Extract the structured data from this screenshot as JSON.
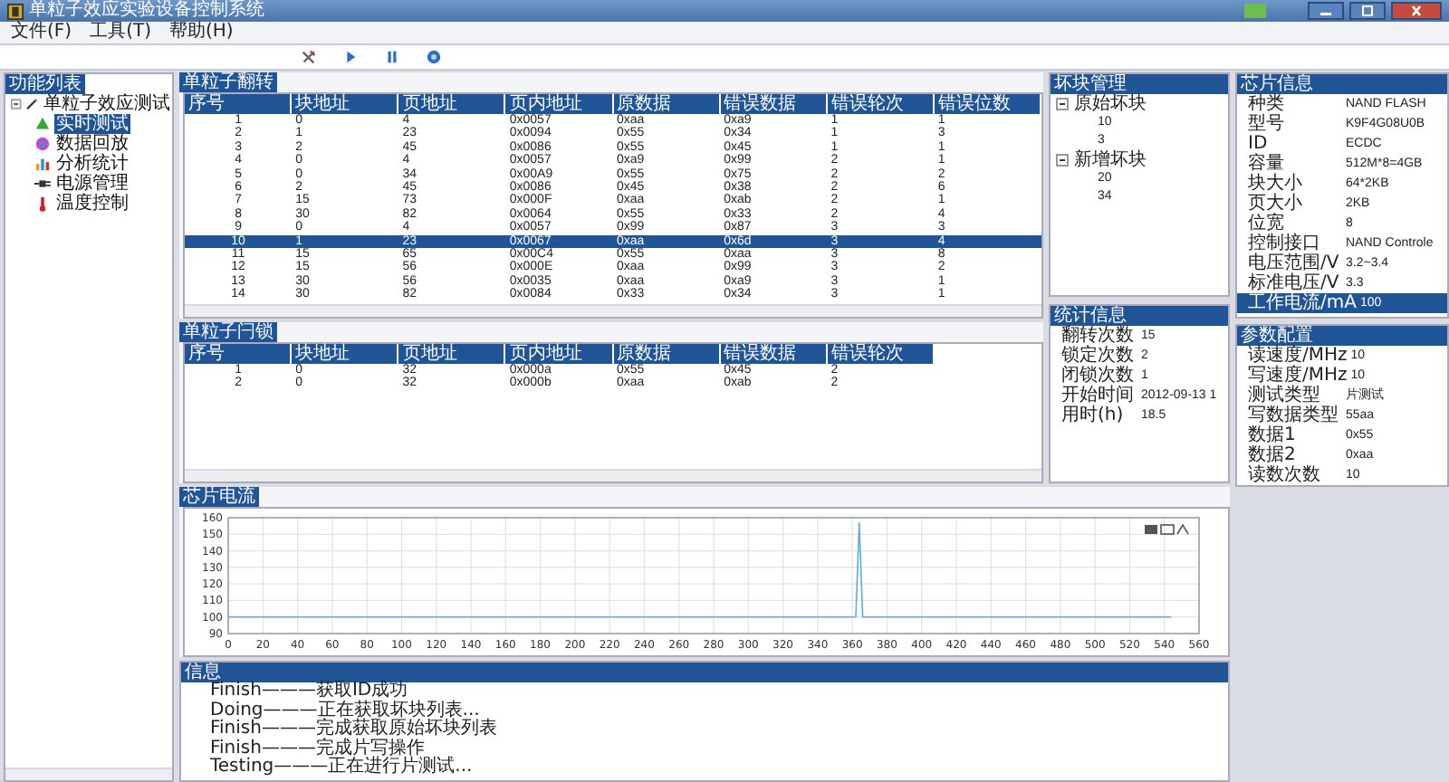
{
  "window": {
    "title": "单粒子效应实验设备控制系统"
  },
  "menu": [
    {
      "label": "文件(F)"
    },
    {
      "label": "工具(T)"
    },
    {
      "label": "帮助(H)"
    }
  ],
  "sidebar": {
    "title": "功能列表",
    "tree": [
      {
        "label": "单粒子效应测试",
        "expanded": true,
        "children": [
          {
            "label": "实时测试",
            "kind": "test",
            "selected": true
          },
          {
            "label": "数据回放",
            "kind": "playback",
            "selected": false
          },
          {
            "label": "分析统计",
            "kind": "stats",
            "selected": false
          },
          {
            "label": "电源管理",
            "kind": "power",
            "selected": false
          },
          {
            "label": "温度控制",
            "kind": "temperature",
            "selected": false
          }
        ]
      }
    ]
  },
  "upset_table": {
    "title": "单粒子翻转",
    "columns": [
      "序号",
      "块地址",
      "页地址",
      "页内地址",
      "原数据",
      "错误数据",
      "错误轮次",
      "错误位数"
    ],
    "rows": [
      {
        "cells": [
          "1",
          "0",
          "4",
          "0x0057",
          "0xaa",
          "0xa9",
          "1",
          "1"
        ],
        "selected": false
      },
      {
        "cells": [
          "2",
          "1",
          "23",
          "0x0094",
          "0x55",
          "0x34",
          "1",
          "3"
        ],
        "selected": false
      },
      {
        "cells": [
          "3",
          "2",
          "45",
          "0x0086",
          "0x55",
          "0x45",
          "1",
          "1"
        ],
        "selected": false
      },
      {
        "cells": [
          "4",
          "0",
          "4",
          "0x0057",
          "0xa9",
          "0x99",
          "2",
          "1"
        ],
        "selected": false
      },
      {
        "cells": [
          "5",
          "0",
          "34",
          "0x00A9",
          "0x55",
          "0x75",
          "2",
          "2"
        ],
        "selected": false
      },
      {
        "cells": [
          "6",
          "2",
          "45",
          "0x0086",
          "0x45",
          "0x38",
          "2",
          "6"
        ],
        "selected": false
      },
      {
        "cells": [
          "7",
          "15",
          "73",
          "0x000F",
          "0xaa",
          "0xab",
          "2",
          "1"
        ],
        "selected": false
      },
      {
        "cells": [
          "8",
          "30",
          "82",
          "0x0064",
          "0x55",
          "0x33",
          "2",
          "4"
        ],
        "selected": false
      },
      {
        "cells": [
          "9",
          "0",
          "4",
          "0x0057",
          "0x99",
          "0x87",
          "3",
          "3"
        ],
        "selected": false
      },
      {
        "cells": [
          "10",
          "1",
          "23",
          "0x0067",
          "0xaa",
          "0x6d",
          "3",
          "4"
        ],
        "selected": true
      },
      {
        "cells": [
          "11",
          "15",
          "65",
          "0x00C4",
          "0x55",
          "0xaa",
          "3",
          "8"
        ],
        "selected": false
      },
      {
        "cells": [
          "12",
          "15",
          "56",
          "0x000E",
          "0xaa",
          "0x99",
          "3",
          "2"
        ],
        "selected": false
      },
      {
        "cells": [
          "13",
          "30",
          "56",
          "0x0035",
          "0xaa",
          "0xa9",
          "3",
          "1"
        ],
        "selected": false
      },
      {
        "cells": [
          "14",
          "30",
          "82",
          "0x0084",
          "0x33",
          "0x34",
          "3",
          "1"
        ],
        "selected": false
      }
    ]
  },
  "latch_table": {
    "title": "单粒子闩锁",
    "columns": [
      "序号",
      "块地址",
      "页地址",
      "页内地址",
      "原数据",
      "错误数据",
      "错误轮次"
    ],
    "rows": [
      {
        "cells": [
          "1",
          "0",
          "32",
          "0x000a",
          "0x55",
          "0x45",
          "2"
        ],
        "selected": false
      },
      {
        "cells": [
          "2",
          "0",
          "32",
          "0x000b",
          "0xaa",
          "0xab",
          "2"
        ],
        "selected": false
      }
    ]
  },
  "bad_blocks": {
    "title": "坏块管理",
    "groups": [
      {
        "label": "原始坏块",
        "expanded": true,
        "children": [
          {
            "label": "10"
          },
          {
            "label": "3"
          }
        ]
      },
      {
        "label": "新增坏块",
        "expanded": true,
        "children": [
          {
            "label": "20"
          },
          {
            "label": "34"
          }
        ]
      }
    ]
  },
  "statistics": {
    "title": "统计信息",
    "rows": [
      {
        "key": "翻转次数",
        "value": "15"
      },
      {
        "key": "锁定次数",
        "value": "2"
      },
      {
        "key": "闭锁次数",
        "value": "1"
      },
      {
        "key": "开始时间",
        "value": "2012-09-13 1"
      },
      {
        "key": "用时(h)",
        "value": "18.5"
      }
    ]
  },
  "chip_info": {
    "title": "芯片信息",
    "rows": [
      {
        "key": "种类",
        "value": "NAND FLASH",
        "selected": false
      },
      {
        "key": "型号",
        "value": "K9F4G08U0B",
        "selected": false
      },
      {
        "key": "ID",
        "value": "ECDC",
        "selected": false
      },
      {
        "key": "容量",
        "value": "512M*8=4GB",
        "selected": false
      },
      {
        "key": "块大小",
        "value": "64*2KB",
        "selected": false
      },
      {
        "key": "页大小",
        "value": "2KB",
        "selected": false
      },
      {
        "key": "位宽",
        "value": "8",
        "selected": false
      },
      {
        "key": "控制接口",
        "value": "NAND Controle",
        "selected": false
      },
      {
        "key": "电压范围/V",
        "value": "3.2~3.4",
        "selected": false
      },
      {
        "key": "标准电压/V",
        "value": "3.3",
        "selected": false
      },
      {
        "key": "工作电流/mA",
        "value": "100",
        "selected": true
      }
    ]
  },
  "parameters": {
    "title": "参数配置",
    "rows": [
      {
        "key": "读速度/MHz",
        "value": "10"
      },
      {
        "key": "写速度/MHz",
        "value": "10"
      },
      {
        "key": "测试类型",
        "value": "片测试"
      },
      {
        "key": "写数据类型",
        "value": "55aa"
      },
      {
        "key": "数据1",
        "value": "0x55"
      },
      {
        "key": "数据2",
        "value": "0xaa"
      },
      {
        "key": "读数次数",
        "value": "10"
      }
    ]
  },
  "current_chart": {
    "title": "芯片电流",
    "chart_data": {
      "type": "line",
      "x": [
        0,
        20,
        40,
        60,
        80,
        100,
        120,
        140,
        160,
        180,
        200,
        220,
        240,
        260,
        280,
        300,
        320,
        340,
        360,
        362,
        364,
        366,
        368,
        380,
        400,
        420,
        440,
        460,
        480,
        500,
        520,
        540,
        544
      ],
      "grid": true,
      "series": [
        {
          "color": "#5aaee0",
          "values": [
            100,
            100,
            100,
            100,
            100,
            100,
            100,
            100,
            100,
            100,
            100,
            100,
            100,
            100,
            100,
            100,
            100,
            100,
            100,
            100,
            157,
            100,
            100,
            100,
            100,
            100,
            100,
            100,
            100,
            100,
            100,
            100,
            100
          ]
        }
      ],
      "xlim": [
        0,
        560
      ],
      "ylim": [
        90,
        160
      ],
      "xticks": [
        0,
        20,
        40,
        60,
        80,
        100,
        120,
        140,
        160,
        180,
        200,
        220,
        240,
        260,
        280,
        300,
        320,
        340,
        360,
        380,
        400,
        420,
        440,
        460,
        480,
        500,
        520,
        540,
        560
      ],
      "yticks": [
        90,
        100,
        110,
        120,
        130,
        140,
        150,
        160
      ]
    }
  },
  "log": {
    "title": "信息",
    "lines": [
      "Finish———获取ID成功",
      "Doing———正在获取坏块列表...",
      "Finish———完成获取原始坏块列表",
      "Finish———完成片写操作",
      "Testing———正在进行片测试..."
    ]
  }
}
